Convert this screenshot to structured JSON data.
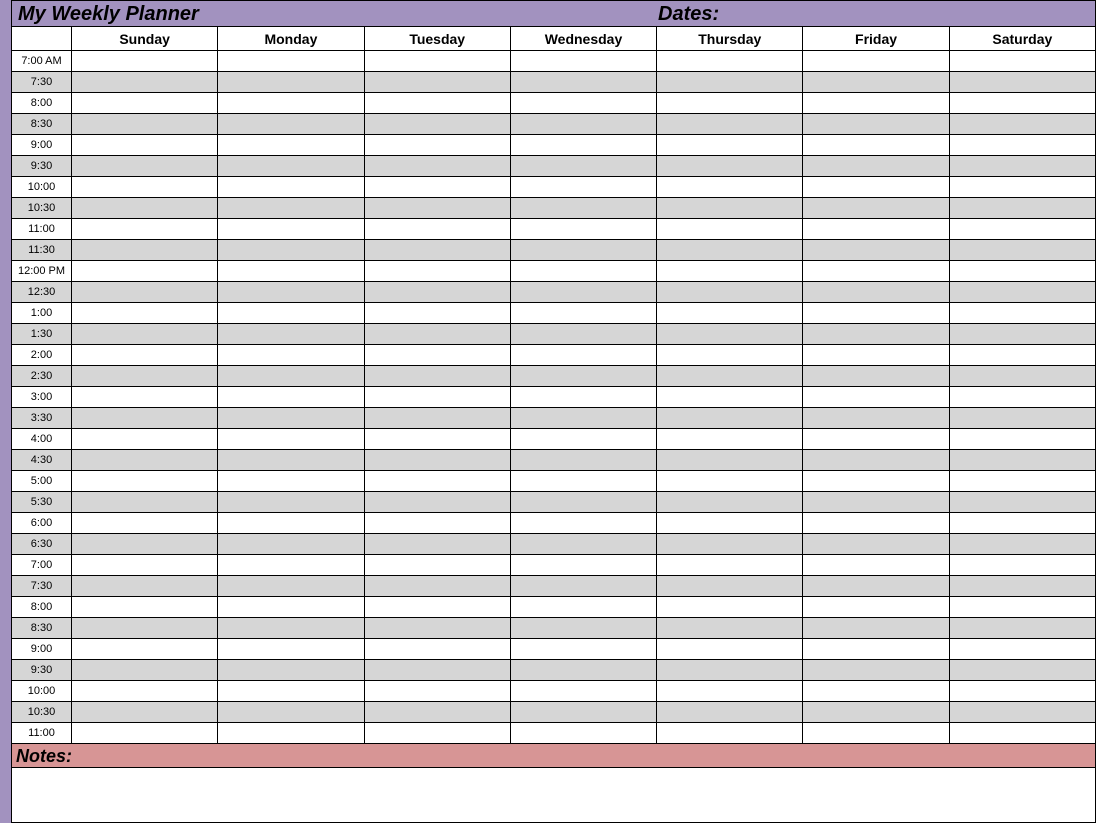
{
  "header": {
    "title": "My Weekly Planner",
    "dates_label": "Dates:"
  },
  "days": [
    "Sunday",
    "Monday",
    "Tuesday",
    "Wednesday",
    "Thursday",
    "Friday",
    "Saturday"
  ],
  "times": [
    "7:00 AM",
    "7:30",
    "8:00",
    "8:30",
    "9:00",
    "9:30",
    "10:00",
    "10:30",
    "11:00",
    "11:30",
    "12:00 PM",
    "12:30",
    "1:00",
    "1:30",
    "2:00",
    "2:30",
    "3:00",
    "3:30",
    "4:00",
    "4:30",
    "5:00",
    "5:30",
    "6:00",
    "6:30",
    "7:00",
    "7:30",
    "8:00",
    "8:30",
    "9:00",
    "9:30",
    "10:00",
    "10:30",
    "11:00"
  ],
  "notes": {
    "label": "Notes:"
  }
}
